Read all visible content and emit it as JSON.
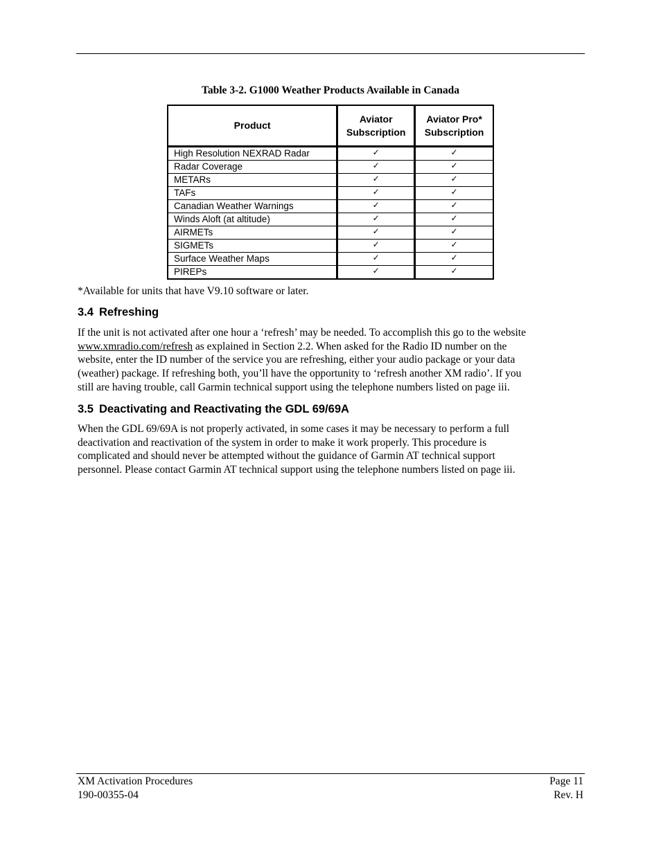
{
  "table": {
    "caption": "Table 3-2.  G1000 Weather Products Available in Canada",
    "headers": {
      "product": "Product",
      "aviator_line1": "Aviator",
      "aviator_line2": "Subscription",
      "pro_line1": "Aviator Pro*",
      "pro_line2": "Subscription"
    },
    "check_icon": "checkmark-icon",
    "check_glyph": "✓",
    "rows": [
      {
        "product": "High Resolution NEXRAD Radar",
        "aviator": "✓",
        "pro": "✓"
      },
      {
        "product": "Radar Coverage",
        "aviator": "✓",
        "pro": "✓"
      },
      {
        "product": "METARs",
        "aviator": "✓",
        "pro": "✓"
      },
      {
        "product": "TAFs",
        "aviator": "✓",
        "pro": "✓"
      },
      {
        "product": "Canadian Weather Warnings",
        "aviator": "✓",
        "pro": "✓"
      },
      {
        "product": "Winds Aloft (at altitude)",
        "aviator": "✓",
        "pro": "✓"
      },
      {
        "product": "AIRMETs",
        "aviator": "✓",
        "pro": "✓"
      },
      {
        "product": "SIGMETs",
        "aviator": "✓",
        "pro": "✓"
      },
      {
        "product": "Surface Weather Maps",
        "aviator": "✓",
        "pro": "✓"
      },
      {
        "product": "PIREPs",
        "aviator": "✓",
        "pro": "✓"
      }
    ],
    "footnote": "*Available for units that have V9.10 software or later."
  },
  "sections": [
    {
      "number": "3.4",
      "title": "Refreshing",
      "lines": [
        {
          "text": "If the unit is not activated after one hour a ‘refresh’ may be needed.  To accomplish this go to the website"
        },
        {
          "link": "www.xmradio.com/refresh",
          "text": " as explained in Section 2.2.  When asked for the Radio ID number on the"
        },
        {
          "text": "website, enter the ID number of the service you are refreshing, either your audio package or your data"
        },
        {
          "text": "(weather) package.  If refreshing both, you’ll have the opportunity to ‘refresh another XM radio’. If you"
        },
        {
          "text": "still are having trouble, call Garmin technical support using the telephone numbers listed on page iii."
        }
      ]
    },
    {
      "number": "3.5",
      "title": "Deactivating and Reactivating the GDL 69/69A",
      "lines": [
        {
          "text": "When the GDL 69/69A is not properly activated, in some cases it may be necessary to perform a full"
        },
        {
          "text": "deactivation and reactivation of the system in order to make it work properly.  This procedure is"
        },
        {
          "text": "complicated and should never be attempted without the guidance of Garmin AT technical support"
        },
        {
          "text": "personnel.  Please contact Garmin AT technical support using the telephone numbers listed on page iii."
        }
      ]
    }
  ],
  "footer": {
    "left_line1": "XM Activation Procedures",
    "left_line2": "190-00355-04",
    "right_line1": "Page 11",
    "right_line2": "Rev. H"
  }
}
